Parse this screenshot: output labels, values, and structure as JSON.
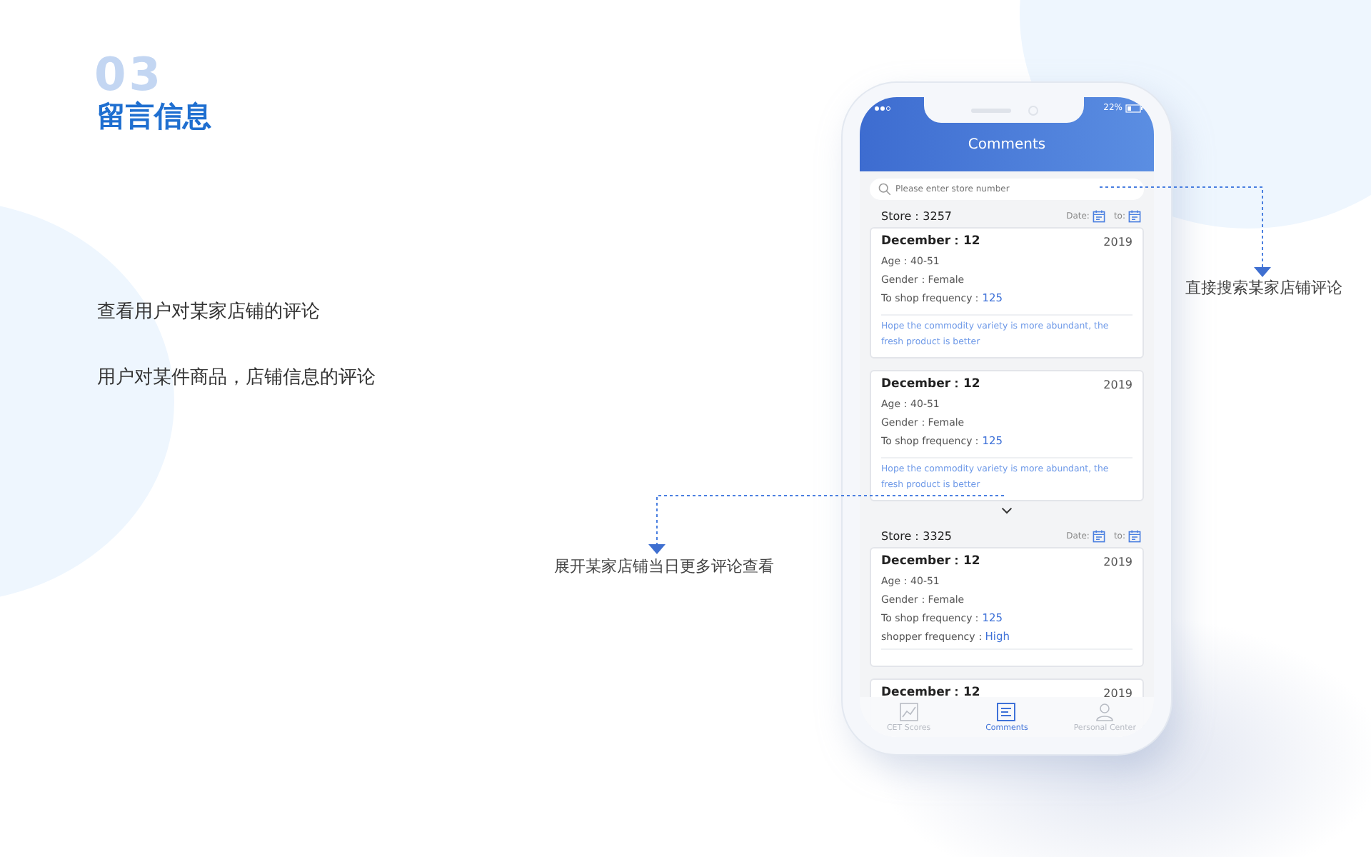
{
  "slide": {
    "section_number": "03",
    "title": "留言信息",
    "points": [
      "查看用户对某家店铺的评论",
      "用户对某件商品，店铺信息的评论"
    ]
  },
  "annotations": [
    {
      "text": "直接搜索某家店铺评论"
    },
    {
      "text": "展开某家店铺当日更多评论查看"
    }
  ],
  "phone": {
    "status_bar": {
      "battery": "22%"
    },
    "header": {
      "title": "Comments"
    },
    "search": {
      "placeholder": "Please enter store number"
    },
    "groups": [
      {
        "store_label": "Store：",
        "store": "3257",
        "date_label": "Date:",
        "to_label": "to:",
        "expandable": true,
        "comments": [
          {
            "date": "December：12",
            "year": "2019",
            "fields": [
              {
                "label": "Age：",
                "value": "40-51",
                "kind": "plain"
              },
              {
                "label": "Gender：",
                "value": "Female",
                "kind": "plain"
              },
              {
                "label": "To shop frequency：",
                "value": "125",
                "kind": "highlight"
              }
            ],
            "note": "Hope the commodity variety is more abundant, the fresh product is better"
          },
          {
            "date": "December：12",
            "year": "2019",
            "fields": [
              {
                "label": "Age：",
                "value": "40-51",
                "kind": "plain"
              },
              {
                "label": "Gender：",
                "value": "Female",
                "kind": "plain"
              },
              {
                "label": "To shop frequency：",
                "value": "125",
                "kind": "highlight"
              }
            ],
            "note": "Hope the commodity variety is more abundant, the fresh product is better"
          }
        ]
      },
      {
        "store_label": "Store：",
        "store": "3325",
        "date_label": "Date:",
        "to_label": "to:",
        "expandable": false,
        "comments": [
          {
            "date": "December：12",
            "year": "2019",
            "fields": [
              {
                "label": "Age：",
                "value": "40-51",
                "kind": "plain"
              },
              {
                "label": "Gender：",
                "value": "Female",
                "kind": "plain"
              },
              {
                "label": "To shop frequency：",
                "value": "125",
                "kind": "highlight"
              },
              {
                "label": "shopper frequency：",
                "value": "High",
                "kind": "highlight"
              }
            ]
          },
          {
            "date": "December：12",
            "year": "2019"
          }
        ]
      }
    ],
    "tab_bar": [
      {
        "label": "CET Scores",
        "kind": "chart",
        "selected": false
      },
      {
        "label": "Comments",
        "kind": "document",
        "selected": true
      },
      {
        "label": "Personal Center",
        "kind": "person",
        "selected": false
      }
    ]
  }
}
